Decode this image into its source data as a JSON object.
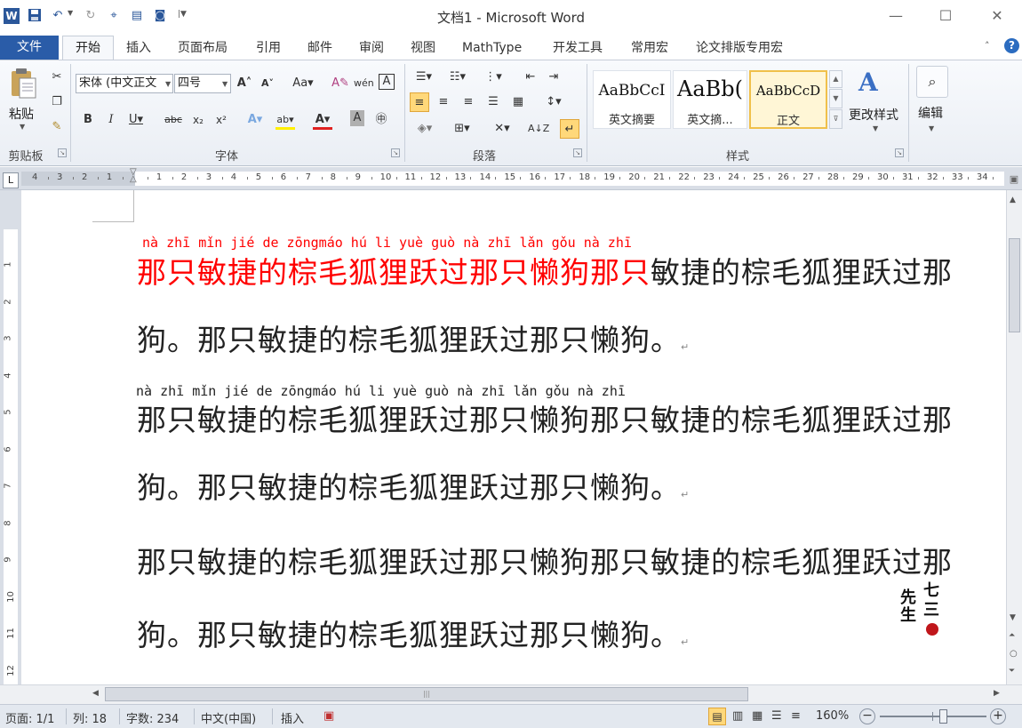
{
  "window": {
    "title": "文档1 - Microsoft Word"
  },
  "qat": {
    "icons": [
      "word-logo-icon",
      "save-icon",
      "undo-icon",
      "redo-icon",
      "format-painter-qat-icon",
      "print-preview-icon",
      "help-qat-icon",
      "customize-qat-icon"
    ]
  },
  "tabs": [
    "文件",
    "开始",
    "插入",
    "页面布局",
    "引用",
    "邮件",
    "审阅",
    "视图",
    "MathType",
    "开发工具",
    "常用宏",
    "论文排版专用宏"
  ],
  "ribbon": {
    "clipboard": {
      "paste_label": "粘贴",
      "group_label": "剪贴板"
    },
    "font": {
      "font_name": "宋体 (中文正文",
      "font_size": "四号",
      "group_label": "字体"
    },
    "paragraph": {
      "group_label": "段落"
    },
    "styles": {
      "items": [
        {
          "sample": "AaBbCcI",
          "name": "英文摘要"
        },
        {
          "sample": "AaBb(",
          "name": "英文摘..."
        },
        {
          "sample": "AaBbCcD",
          "name": "正文"
        }
      ],
      "change_styles": "更改样式",
      "group_label": "样式"
    },
    "editing": {
      "label": "编辑"
    }
  },
  "ruler": {
    "numbers": [
      "4",
      "3",
      "2",
      "1",
      "",
      "1",
      "2",
      "3",
      "4",
      "5",
      "6",
      "7",
      "8",
      "9",
      "10",
      "11",
      "12",
      "13",
      "14",
      "15",
      "16",
      "17",
      "18",
      "19",
      "20",
      "21",
      "22",
      "23",
      "24",
      "25",
      "26",
      "27",
      "28",
      "29",
      "30",
      "31",
      "32",
      "33",
      "34"
    ]
  },
  "vruler": {
    "numbers": [
      "1",
      "2",
      "3",
      "4",
      "5",
      "6",
      "7",
      "8",
      "9",
      "10",
      "11",
      "12"
    ]
  },
  "document": {
    "pinyin1": "nà  zhī mǐn jié  de  zōngmáo hú  li  yuè guò  nà  zhī  lǎn gǒu  nà  zhī",
    "line1_red": "那只敏捷的棕毛狐狸跃过那只懒狗那只",
    "line1_rest": "敏捷的棕毛狐狸跃过那",
    "line2": "狗。那只敏捷的棕毛狐狸跃过那只懒狗。",
    "pinyin2": "nà  zhī mǐn jié de  zōngmáo hú  li  yuè guò nà  zhī lǎn gǒu nà  zhī",
    "line3": "那只敏捷的棕毛狐狸跃过那只懒狗那只敏捷的棕毛狐狸跃过那",
    "line4": "狗。那只敏捷的棕毛狐狸跃过那只懒狗。",
    "line5": "那只敏捷的棕毛狐狸跃过那只懒狗那只敏捷的棕毛狐狸跃过那",
    "line6": "狗。那只敏捷的棕毛狐狸跃过那只懒狗。",
    "para_mark": "↵",
    "red_color": "#ff0000"
  },
  "watermark": {
    "text": "七三先生"
  },
  "status": {
    "page": "页面: 1/1",
    "column": "列: 18",
    "word_count": "字数: 234",
    "language": "中文(中国)",
    "insert_mode": "插入",
    "zoom": "160%",
    "zoom_level_percent": 60
  }
}
